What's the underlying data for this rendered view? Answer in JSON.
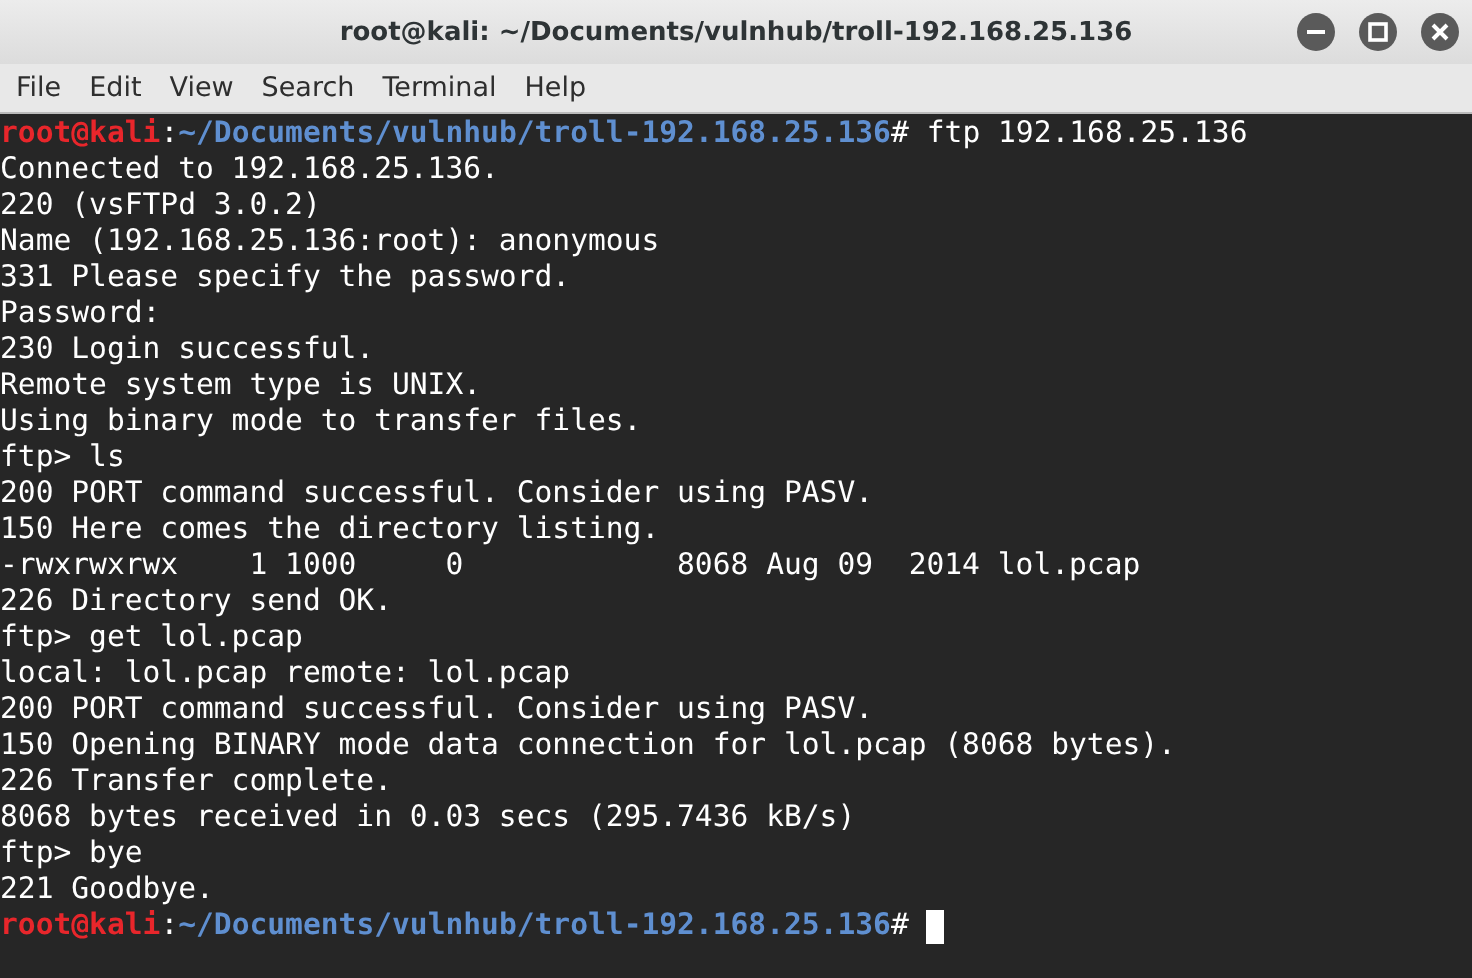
{
  "window": {
    "title": "root@kali: ~/Documents/vulnhub/troll-192.168.25.136"
  },
  "menu": [
    "File",
    "Edit",
    "View",
    "Search",
    "Terminal",
    "Help"
  ],
  "terminal": {
    "lines": [
      {
        "kind": "prompt",
        "user": "root@kali",
        "separator": ":",
        "path": "~/Documents/vulnhub/troll-192.168.25.136",
        "sign": "#",
        "command": "ftp 192.168.25.136"
      },
      {
        "kind": "output",
        "text": "Connected to 192.168.25.136."
      },
      {
        "kind": "output",
        "text": "220 (vsFTPd 3.0.2)"
      },
      {
        "kind": "output",
        "text": "Name (192.168.25.136:root): anonymous"
      },
      {
        "kind": "output",
        "text": "331 Please specify the password."
      },
      {
        "kind": "output",
        "text": "Password:"
      },
      {
        "kind": "output",
        "text": "230 Login successful."
      },
      {
        "kind": "output",
        "text": "Remote system type is UNIX."
      },
      {
        "kind": "output",
        "text": "Using binary mode to transfer files."
      },
      {
        "kind": "output",
        "text": "ftp> ls"
      },
      {
        "kind": "output",
        "text": "200 PORT command successful. Consider using PASV."
      },
      {
        "kind": "output",
        "text": "150 Here comes the directory listing."
      },
      {
        "kind": "output",
        "text": "-rwxrwxrwx    1 1000     0            8068 Aug 09  2014 lol.pcap"
      },
      {
        "kind": "output",
        "text": "226 Directory send OK."
      },
      {
        "kind": "output",
        "text": "ftp> get lol.pcap"
      },
      {
        "kind": "output",
        "text": "local: lol.pcap remote: lol.pcap"
      },
      {
        "kind": "output",
        "text": "200 PORT command successful. Consider using PASV."
      },
      {
        "kind": "output",
        "text": "150 Opening BINARY mode data connection for lol.pcap (8068 bytes)."
      },
      {
        "kind": "output",
        "text": "226 Transfer complete."
      },
      {
        "kind": "output",
        "text": "8068 bytes received in 0.03 secs (295.7436 kB/s)"
      },
      {
        "kind": "output",
        "text": "ftp> bye"
      },
      {
        "kind": "output",
        "text": "221 Goodbye."
      },
      {
        "kind": "prompt",
        "user": "root@kali",
        "separator": ":",
        "path": "~/Documents/vulnhub/troll-192.168.25.136",
        "sign": "#",
        "cursor": true
      }
    ]
  }
}
